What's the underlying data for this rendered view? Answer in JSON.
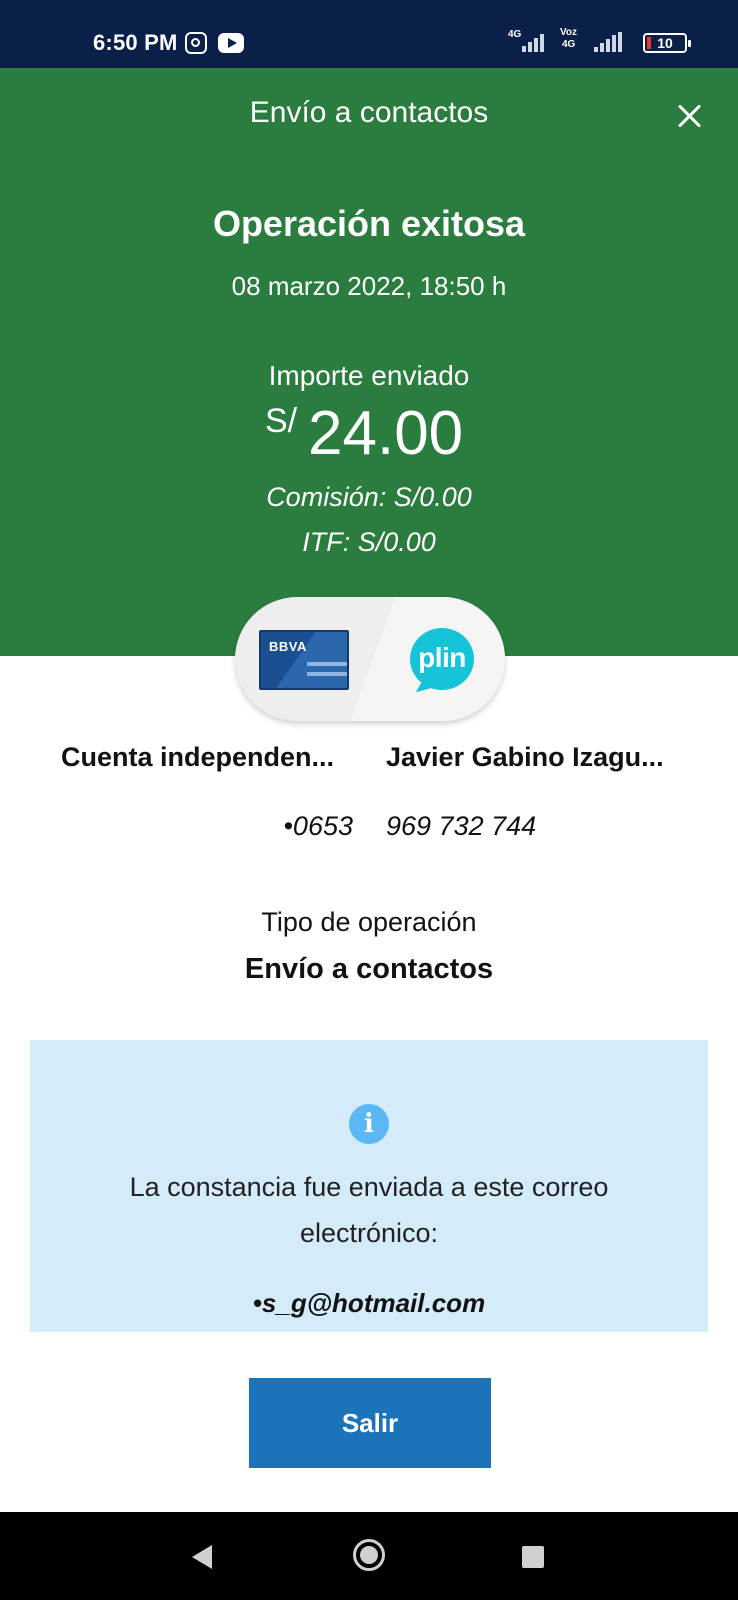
{
  "status_bar": {
    "time": "6:50 PM",
    "network_1": "4G",
    "network_2_line1": "Voz",
    "network_2_line2": "4G",
    "battery": "10",
    "notification_icons": [
      "instagram-icon",
      "youtube-icon"
    ]
  },
  "header": {
    "title": "Envío a contactos",
    "close_icon": "close-icon"
  },
  "result": {
    "title": "Operación exitosa",
    "date": "08 marzo 2022, 18:50 h",
    "amount_label": "Importe enviado",
    "currency": "S/",
    "amount": "24.00",
    "commission": "Comisión:  S/0.00",
    "itf": "ITF:  S/0.00"
  },
  "transfer": {
    "from_logo": "BBVA",
    "to_logo": "plin",
    "from_name": "Cuenta independen...",
    "from_number": "•0653",
    "to_name": "Javier Gabino Izagu...",
    "to_number": "969 732 744"
  },
  "operation": {
    "label": "Tipo de operación",
    "value": "Envío a contactos"
  },
  "info": {
    "icon": "info-icon",
    "icon_glyph": "i",
    "message": "La constancia fue enviada a este correo electrónico:",
    "email": "•s_g@hotmail.com"
  },
  "actions": {
    "exit_label": "Salir"
  },
  "colors": {
    "status_bar": "#0a2048",
    "header_green": "#2a7d3e",
    "info_box": "#d4ebfa",
    "button_blue": "#1b73ba",
    "plin_cyan": "#17c3d8"
  }
}
